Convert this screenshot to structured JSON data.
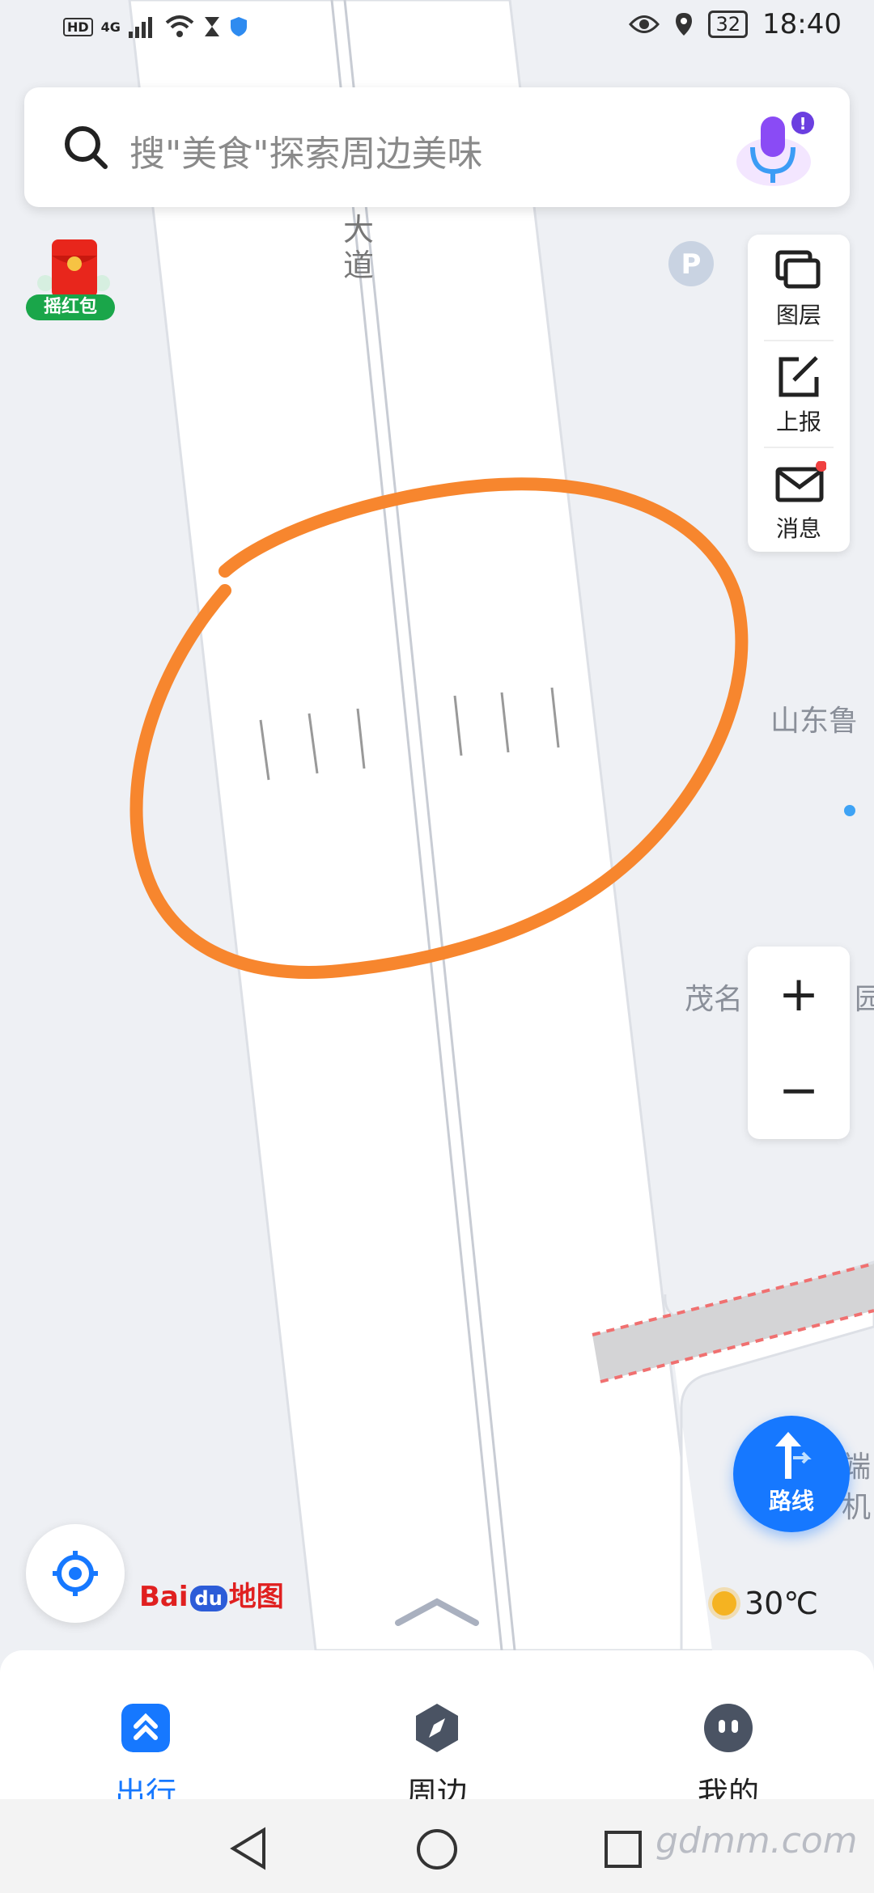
{
  "status_bar": {
    "network": "4G",
    "battery": "32",
    "time": "18:40"
  },
  "search": {
    "placeholder": "搜\"美食\"探索周边美味"
  },
  "red_packet": {
    "label": "摇红包"
  },
  "tools": [
    {
      "label": "图层",
      "icon": "layers-icon"
    },
    {
      "label": "上报",
      "icon": "report-icon"
    },
    {
      "label": "消息",
      "icon": "message-icon"
    }
  ],
  "map": {
    "road_label": "大道",
    "poi_labels": [
      "山东鲁",
      "茂名",
      "园",
      "端",
      "机"
    ],
    "colors": {
      "annotation": "#f7862e",
      "road": "#ffffff",
      "background": "#eef0f4"
    }
  },
  "zoom": {
    "in": "+",
    "out": "−"
  },
  "route_button": {
    "label": "路线"
  },
  "logo": {
    "text": "Bai",
    "paw": "du",
    "suffix": "地图"
  },
  "weather": {
    "temperature": "30℃"
  },
  "bottom_nav": [
    {
      "label": "出行",
      "active": true
    },
    {
      "label": "周边",
      "active": false
    },
    {
      "label": "我的",
      "active": false
    }
  ],
  "watermark": "gdmm.com"
}
